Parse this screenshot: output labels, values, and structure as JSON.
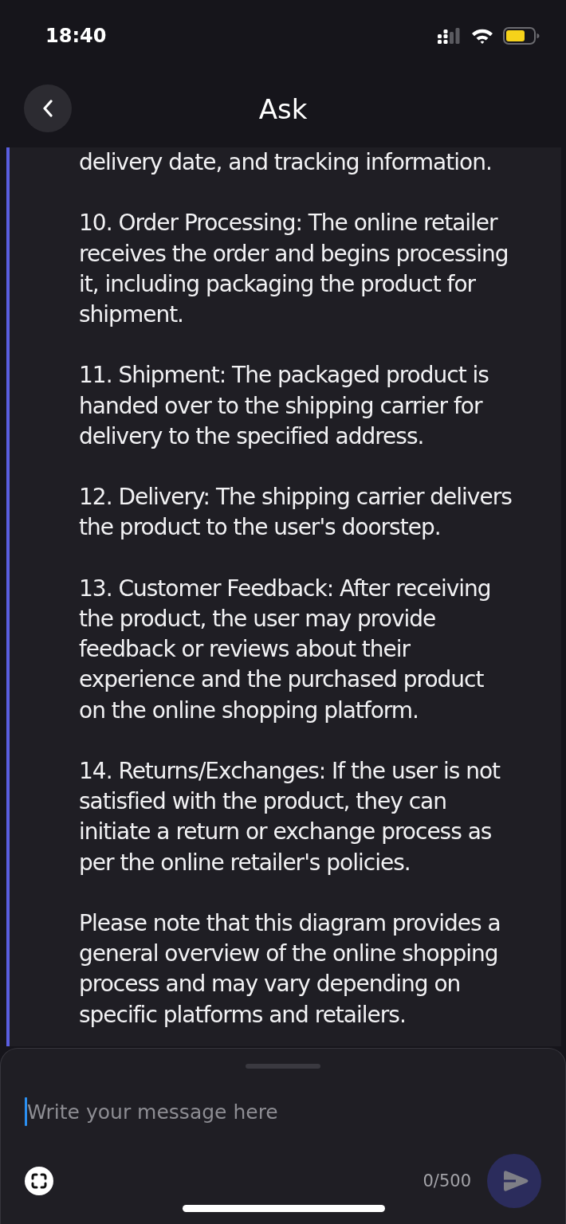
{
  "status_bar": {
    "time": "18:40"
  },
  "nav": {
    "title": "Ask"
  },
  "message": {
    "paragraphs": [
      "delivery date, and tracking information.",
      "10. Order Processing: The online retailer receives the order and begins processing it, including packaging the product for shipment.",
      "11. Shipment: The packaged product is handed over to the shipping carrier for delivery to the specified address.",
      "12. Delivery: The shipping carrier delivers the product to the user's doorstep.",
      "13. Customer Feedback: After receiving the product, the user may provide feedback or reviews about their experience and the purchased product on the online shopping platform.",
      "14. Returns/Exchanges: If the user is not satisfied with the product, they can initiate a return or exchange process as per the online retailer's policies.",
      "Please note that this diagram provides a general overview of the online shopping process and may vary depending on specific platforms and retailers."
    ]
  },
  "composer": {
    "placeholder": "Write your message here",
    "counter": "0/500",
    "send_button": {
      "disabled": true
    }
  }
}
